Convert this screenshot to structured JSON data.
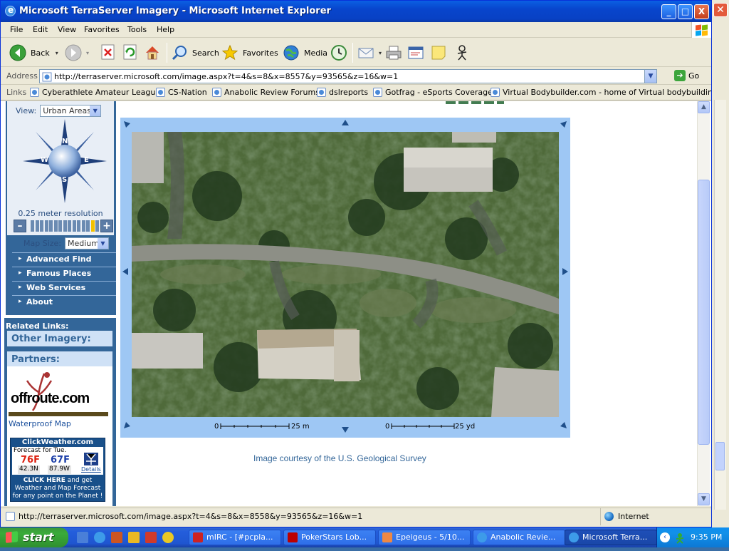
{
  "window": {
    "title": "Microsoft TerraServer Imagery - Microsoft Internet Explorer",
    "minimize": "_",
    "maximize": "□",
    "close": "X"
  },
  "menu": [
    "File",
    "Edit",
    "View",
    "Favorites",
    "Tools",
    "Help"
  ],
  "toolbar": {
    "back": "Back",
    "search": "Search",
    "favorites": "Favorites",
    "media": "Media"
  },
  "address": {
    "label": "Address",
    "url": "http://terraserver.microsoft.com/image.aspx?t=4&s=8&x=8557&y=93565&z=16&w=1",
    "go": "Go"
  },
  "links": {
    "label": "Links",
    "items": [
      "Cyberathlete Amateur League",
      "CS-Nation",
      "Anabolic Review Forums",
      "dslreports",
      "Gotfrag - eSports Coverage",
      "Virtual Bodybuilder.com - home of Virtual bodybuilding"
    ]
  },
  "sidebar": {
    "view_label": "View:",
    "view_value": "Urban Areas",
    "compass": {
      "n": "N",
      "s": "S",
      "e": "E",
      "w": "W"
    },
    "resolution": "0.25 meter resolution",
    "zoom_minus": "–",
    "zoom_plus": "+",
    "zoom_level": 14,
    "zoom_steps": 15,
    "map_size_label": "Map Size:",
    "map_size_value": "Medium",
    "nav": [
      "Advanced Find",
      "Famous Places",
      "Web Services",
      "About"
    ]
  },
  "related": {
    "label": "Related Links:",
    "other_imagery": "Other Imagery:",
    "partners": "Partners:",
    "offroute_logo": "offroute.com",
    "waterproof": "Waterproof Map"
  },
  "weather": {
    "title": "ClickWeather.com",
    "forecast": "Forecast for Tue.",
    "hi": "76F",
    "lo": "67F",
    "lat": "42.3N",
    "lon": "87.9W",
    "details": "Details",
    "cta_bold": "CLICK HERE",
    "cta_1": " and get",
    "cta_2": "Weather and Map Forecast",
    "cta_3": "for any point on the Planet !"
  },
  "map": {
    "scale_m_zero": "0",
    "scale_m": "25 m",
    "scale_yd_zero": "0",
    "scale_yd": "25 yd",
    "courtesy": "Image courtesy of the U.S. Geological Survey"
  },
  "status": {
    "text": "http://terraserver.microsoft.com/image.aspx?t=4&s=8&x=8558&y=93565&z=16&w=1",
    "zone": "Internet"
  },
  "taskbar": {
    "start": "start",
    "tasks": [
      "mIRC - [#pcpla...",
      "PokerStars Lob...",
      "Epeigeus - 5/10...",
      "Anabolic Revie...",
      "Microsoft Terra..."
    ],
    "clock": "9:35 PM"
  },
  "colors": {
    "titlebar": "#0845cc",
    "sidebar": "#336699",
    "mapframe": "#9ec7f4"
  }
}
